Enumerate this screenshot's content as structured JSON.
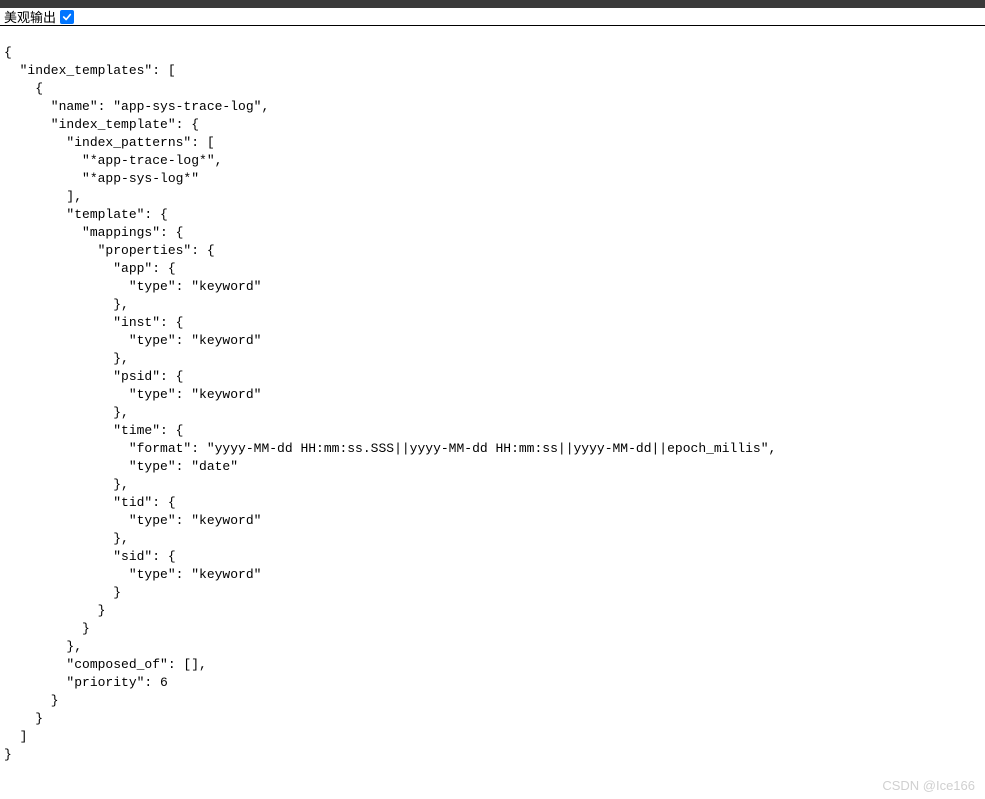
{
  "header": {
    "pretty_output_label": "美观输出",
    "checkbox_checked": true
  },
  "json_content": "{\n  \"index_templates\": [\n    {\n      \"name\": \"app-sys-trace-log\",\n      \"index_template\": {\n        \"index_patterns\": [\n          \"*app-trace-log*\",\n          \"*app-sys-log*\"\n        ],\n        \"template\": {\n          \"mappings\": {\n            \"properties\": {\n              \"app\": {\n                \"type\": \"keyword\"\n              },\n              \"inst\": {\n                \"type\": \"keyword\"\n              },\n              \"psid\": {\n                \"type\": \"keyword\"\n              },\n              \"time\": {\n                \"format\": \"yyyy-MM-dd HH:mm:ss.SSS||yyyy-MM-dd HH:mm:ss||yyyy-MM-dd||epoch_millis\",\n                \"type\": \"date\"\n              },\n              \"tid\": {\n                \"type\": \"keyword\"\n              },\n              \"sid\": {\n                \"type\": \"keyword\"\n              }\n            }\n          }\n        },\n        \"composed_of\": [],\n        \"priority\": 6\n      }\n    }\n  ]\n}",
  "watermark": "CSDN @Ice166"
}
